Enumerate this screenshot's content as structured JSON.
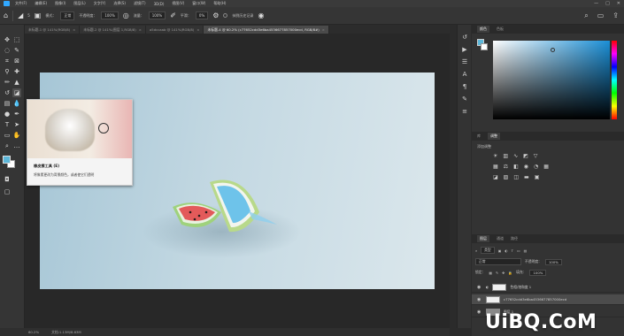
{
  "menu": {
    "items": [
      "文件(F)",
      "编辑(E)",
      "图像(I)",
      "图层(L)",
      "文字(Y)",
      "选择(S)",
      "滤镜(T)",
      "3D(D)",
      "视图(V)",
      "窗口(W)",
      "帮助(H)"
    ],
    "window_controls": [
      "—",
      "□",
      "✕"
    ]
  },
  "options": {
    "brush_size": "5",
    "mode_label": "模式：",
    "mode_value": "正常",
    "opacity_label": "不透明度：",
    "opacity_value": "100%",
    "flow_label": "流量：",
    "flow_value": "100%",
    "smooth_label": "平滑：",
    "smooth_value": "0%",
    "history_label": "抹到历史记录"
  },
  "tabs": [
    {
      "label": "未标题-1 @ 141%(RGB/8)",
      "active": false
    },
    {
      "label": "未标题-2 @ 141%(图层 1,RGB/8)",
      "active": false
    },
    {
      "label": "a5dccaab @ 141%(RGB/8)",
      "active": false
    },
    {
      "label": "未标题-4 @ 60.2% (c77652cdd3e6ba4536677857000ecd, RGB/8#)",
      "active": true
    }
  ],
  "tooltip": {
    "title": "橡皮擦工具 (E)",
    "description": "将像素更改为背景颜色，或者使它们透明"
  },
  "status": {
    "zoom": "60.2%",
    "doc": "文档:1.13M/8.63M"
  },
  "color_panel": {
    "tabs": [
      "颜色",
      "色板"
    ],
    "foreground": "#5cb7d9",
    "background": "#ffffff",
    "field_hue": "#1b8fd6"
  },
  "adjust_panel": {
    "tabs": [
      "库",
      "调整"
    ],
    "title": "添加调整"
  },
  "layers_panel": {
    "tabs": [
      "图层",
      "通道",
      "路径"
    ],
    "filter_label": "类型",
    "blend_mode": "正常",
    "opacity_label": "不透明度：",
    "opacity_value": "100%",
    "lock_label": "锁定：",
    "fill_label": "填充：",
    "fill_value": "100%",
    "layers": [
      {
        "name": "色相/饱和度 1",
        "selected": false
      },
      {
        "name": "c77652cdd3e6ba4536677857000ecd",
        "selected": true
      },
      {
        "name": "图层 1",
        "selected": false
      }
    ]
  },
  "watermark": "UiBQ.CoM"
}
